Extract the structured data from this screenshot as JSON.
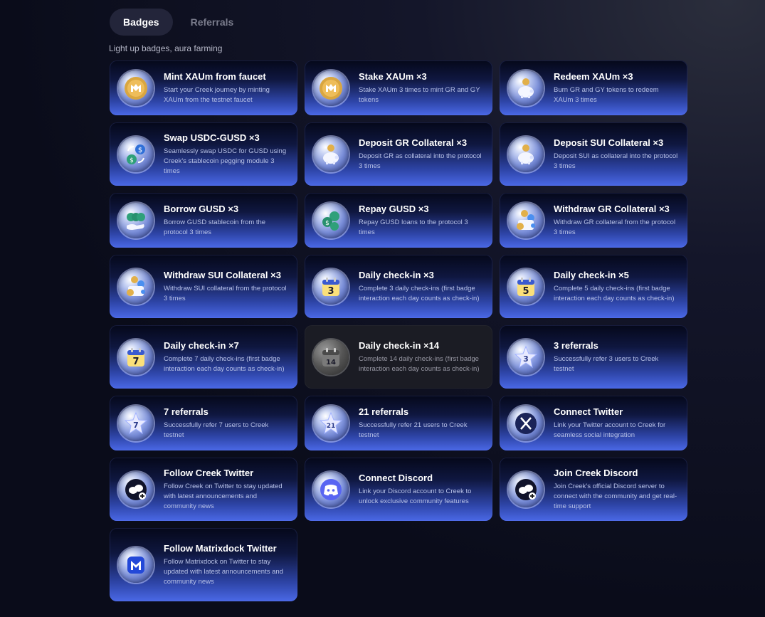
{
  "tabs": [
    {
      "label": "Badges",
      "active": true
    },
    {
      "label": "Referrals",
      "active": false
    }
  ],
  "subtitle": "Light up badges, aura farming",
  "badges": [
    {
      "title": "Mint XAUm from faucet",
      "desc": "Start your Creek journey by minting XAUm from the testnet faucet",
      "icon": "xaum-coin-icon",
      "locked": false
    },
    {
      "title": "Stake XAUm ×3",
      "desc": "Stake XAUm 3 times to mint GR and GY tokens",
      "icon": "xaum-coin-icon",
      "locked": false
    },
    {
      "title": "Redeem XAUm ×3",
      "desc": "Burn GR and GY tokens to redeem XAUm 3 times",
      "icon": "piggy-bank-icon",
      "locked": false
    },
    {
      "title": "Swap USDC-GUSD ×3",
      "desc": "Seamlessly swap USDC for GUSD using Creek's stablecoin pegging module 3 times",
      "icon": "swap-coins-icon",
      "locked": false
    },
    {
      "title": "Deposit GR Collateral ×3",
      "desc": "Deposit GR as collateral into the protocol 3 times",
      "icon": "piggy-bank-icon",
      "locked": false
    },
    {
      "title": "Deposit SUI Collateral ×3",
      "desc": "Deposit SUI as collateral into the protocol 3 times",
      "icon": "piggy-bank-icon",
      "locked": false
    },
    {
      "title": "Borrow GUSD ×3",
      "desc": "Borrow GUSD stablecoin from the protocol 3 times",
      "icon": "hand-coins-icon",
      "locked": false
    },
    {
      "title": "Repay GUSD ×3",
      "desc": "Repay GUSD loans to the protocol 3 times",
      "icon": "coins-icon",
      "locked": false
    },
    {
      "title": "Withdraw GR Collateral ×3",
      "desc": "Withdraw GR collateral from the protocol 3 times",
      "icon": "wallet-coins-icon",
      "locked": false
    },
    {
      "title": "Withdraw SUI Collateral ×3",
      "desc": "Withdraw SUI collateral from the protocol 3 times",
      "icon": "wallet-coins-icon",
      "locked": false
    },
    {
      "title": "Daily check-in ×3",
      "desc": "Complete 3 daily check-ins (first badge interaction each day counts as check-in)",
      "icon": "calendar-icon",
      "num": "3",
      "locked": false
    },
    {
      "title": "Daily check-in ×5",
      "desc": "Complete 5 daily check-ins (first badge interaction each day counts as check-in)",
      "icon": "calendar-icon",
      "num": "5",
      "locked": false
    },
    {
      "title": "Daily check-in ×7",
      "desc": "Complete 7 daily check-ins (first badge interaction each day counts as check-in)",
      "icon": "calendar-icon",
      "num": "7",
      "locked": false
    },
    {
      "title": "Daily check-in ×14",
      "desc": "Complete 14 daily check-ins (first badge interaction each day counts as check-in)",
      "icon": "calendar-icon",
      "num": "14",
      "locked": true
    },
    {
      "title": "3 referrals",
      "desc": "Successfully refer 3 users to Creek testnet",
      "icon": "star-icon",
      "num": "3",
      "locked": false
    },
    {
      "title": "7 referrals",
      "desc": "Successfully refer 7 users to Creek testnet",
      "icon": "star-icon",
      "num": "7",
      "locked": false
    },
    {
      "title": "21 referrals",
      "desc": "Successfully refer 21 users to Creek testnet",
      "icon": "star-icon",
      "num": "21",
      "locked": false
    },
    {
      "title": "Connect Twitter",
      "desc": "Link your Twitter account to Creek for seamless social integration",
      "icon": "x-logo-icon",
      "locked": false
    },
    {
      "title": "Follow Creek Twitter",
      "desc": "Follow Creek on Twitter to stay updated with latest announcements and community news",
      "icon": "creek-logo-icon",
      "locked": false
    },
    {
      "title": "Connect Discord",
      "desc": "Link your Discord account to Creek to unlock exclusive community features",
      "icon": "discord-icon",
      "locked": false
    },
    {
      "title": "Join Creek Discord",
      "desc": "Join Creek's official Discord server to connect with the community and get real-time support",
      "icon": "creek-logo-icon",
      "locked": false
    },
    {
      "title": "Follow Matrixdock Twitter",
      "desc": "Follow Matrixdock on Twitter to stay updated with latest announcements and community news",
      "icon": "matrixdock-logo-icon",
      "locked": false
    }
  ]
}
